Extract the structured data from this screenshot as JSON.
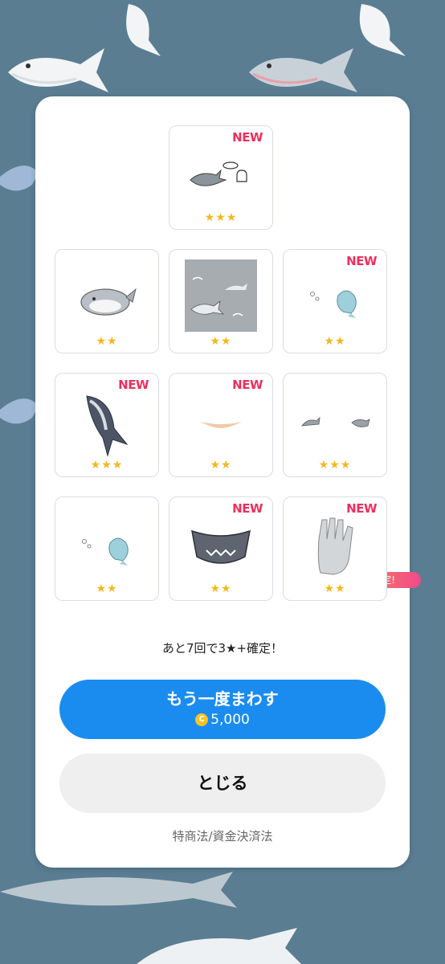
{
  "results": [
    {
      "name": "shark-sticker-set",
      "new": true,
      "stars": "★★★"
    },
    {
      "name": "shark-plush-bag",
      "new": false,
      "stars": "★★"
    },
    {
      "name": "shark-pattern-background",
      "new": false,
      "stars": "★★"
    },
    {
      "name": "blue-whale-bubbles-a",
      "new": true,
      "stars": "★★"
    },
    {
      "name": "jumping-shark",
      "new": true,
      "stars": "★★★"
    },
    {
      "name": "shark-mouth-lips",
      "new": true,
      "stars": "★★"
    },
    {
      "name": "small-fish-pair",
      "new": false,
      "stars": "★★★"
    },
    {
      "name": "blue-whale-bubbles-b",
      "new": false,
      "stars": "★★"
    },
    {
      "name": "shark-mask",
      "new": true,
      "stars": "★★"
    },
    {
      "name": "grey-claw-glove",
      "new": true,
      "stars": "★★"
    }
  ],
  "new_label": "NEW",
  "guarantee_badge": "3★+確定!",
  "counter_text": "あと7回で3★+確定！",
  "spin_again": {
    "label": "もう一度まわす",
    "coin_symbol": "C",
    "price": "5,000"
  },
  "close_label": "とじる",
  "legal_link": "特商法/資金決済法",
  "colors": {
    "primary": "#1a8cf0",
    "new_badge": "#ee2f5e",
    "stars": "#f5b81a",
    "background": "#5a7d92"
  }
}
